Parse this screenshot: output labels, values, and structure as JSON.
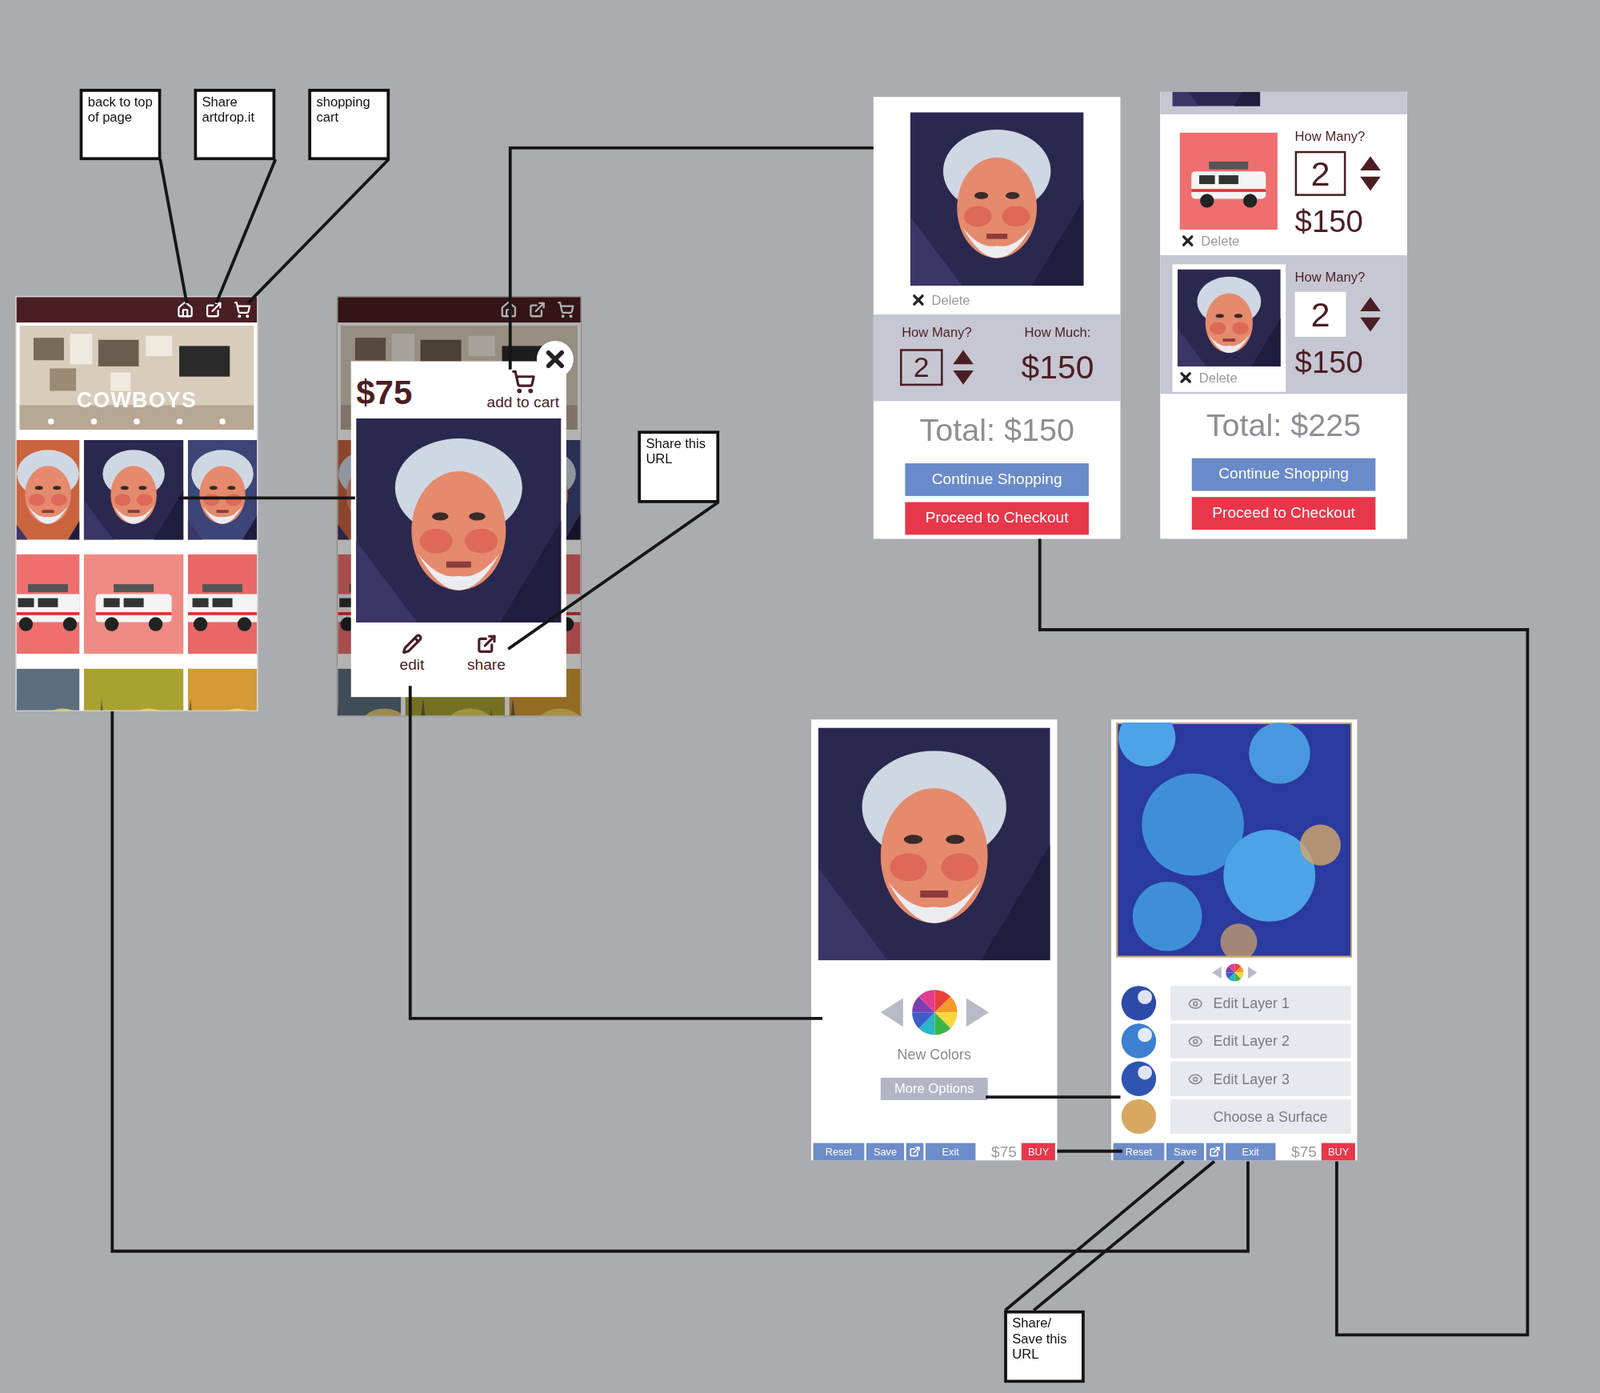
{
  "annotations": [
    {
      "text": "back to top of page"
    },
    {
      "text": "Share artdrop.it"
    },
    {
      "text": "shopping cart"
    },
    {
      "text": "Share this URL"
    },
    {
      "text": "Share/ Save this URL"
    }
  ],
  "gallery": {
    "hero_title": "COWBOYS",
    "dots": [
      {
        "selected": false
      },
      {
        "selected": false
      },
      {
        "selected": false
      },
      {
        "selected": false
      },
      {
        "selected": false
      }
    ],
    "rows": [
      [
        {
          "kind": "portrait",
          "color": "#c9643f"
        },
        {
          "kind": "portrait",
          "color": "#2b2850"
        },
        {
          "kind": "portrait",
          "color": "#3b4578"
        }
      ],
      [
        {
          "kind": "car",
          "color": "#ef6f6f"
        },
        {
          "kind": "car",
          "color": "#f08a84"
        },
        {
          "kind": "car",
          "color": "#ea6767"
        }
      ],
      [
        {
          "kind": "landscape",
          "color": "#5d6e80"
        },
        {
          "kind": "landscape",
          "color": "#a9a231"
        },
        {
          "kind": "landscape",
          "color": "#d39a35"
        }
      ]
    ]
  },
  "detail_popup": {
    "price": "$75",
    "add_to_cart": "add to cart",
    "actions": [
      {
        "label": "edit",
        "kind": "edit"
      },
      {
        "label": "share",
        "kind": "share"
      }
    ]
  },
  "cart_single": {
    "item": {
      "kind": "portrait",
      "delete": "Delete",
      "qty_label": "How Many?",
      "price_label": "How Much:",
      "qty": "2",
      "price": "$150"
    },
    "total": "Total: $150",
    "buttons": [
      {
        "label": "Continue Shopping",
        "kind": "secondary"
      },
      {
        "label": "Proceed to Checkout",
        "kind": "primary"
      }
    ]
  },
  "cart_list": {
    "partial_item": {
      "kind": "portrait"
    },
    "items": [
      {
        "kind": "car",
        "delete": "Delete",
        "qty_label": "How Many?",
        "qty": "2",
        "price": "$150"
      },
      {
        "kind": "portrait",
        "delete": "Delete",
        "qty_label": "How Many?",
        "qty": "2",
        "price": "$150"
      }
    ],
    "total": "Total: $225",
    "buttons": [
      {
        "label": "Continue Shopping",
        "kind": "secondary"
      },
      {
        "label": "Proceed to Checkout",
        "kind": "primary"
      }
    ]
  },
  "editor_simple": {
    "colors_label": "New Colors",
    "more_options": "More Options",
    "toolbar": {
      "items": [
        {
          "label": "Reset",
          "kind": "button"
        },
        {
          "label": "Save",
          "kind": "button"
        },
        {
          "label": "",
          "kind": "share"
        },
        {
          "label": "Exit",
          "kind": "button"
        }
      ],
      "price": "$75",
      "buy": "BUY"
    }
  },
  "editor_layers": {
    "layers": [
      {
        "label": "Edit Layer 1",
        "kind": "layer",
        "visible": true,
        "color": "#2c4aa8"
      },
      {
        "label": "Edit Layer 2",
        "kind": "layer",
        "visible": true,
        "color": "#3d7fd0"
      },
      {
        "label": "Edit Layer 3",
        "kind": "layer",
        "visible": true,
        "color": "#2e55b0"
      },
      {
        "label": "Choose a Surface",
        "kind": "surface",
        "visible": false,
        "color": "#d9a860"
      }
    ],
    "toolbar": {
      "items": [
        {
          "label": "Reset",
          "kind": "button"
        },
        {
          "label": "Save",
          "kind": "button"
        },
        {
          "label": "",
          "kind": "share"
        },
        {
          "label": "Exit",
          "kind": "button"
        }
      ],
      "price": "$75",
      "buy": "BUY"
    }
  }
}
